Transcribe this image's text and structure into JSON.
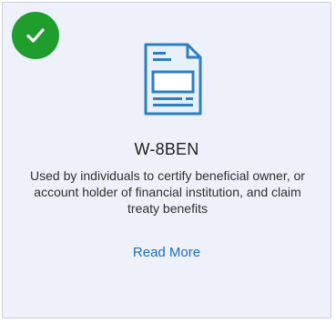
{
  "card": {
    "selected": true,
    "icon": "document-icon",
    "badge_icon": "check-icon",
    "title": "W-8BEN",
    "description": "Used by individuals to certify beneficial owner, or account holder of financial institution, and claim treaty benefits",
    "link_label": "Read More"
  },
  "colors": {
    "card_background": "#eef1fa",
    "badge_green": "#1f9d2d",
    "icon_blue": "#2f7fc0",
    "link_blue": "#1f6fb8"
  }
}
